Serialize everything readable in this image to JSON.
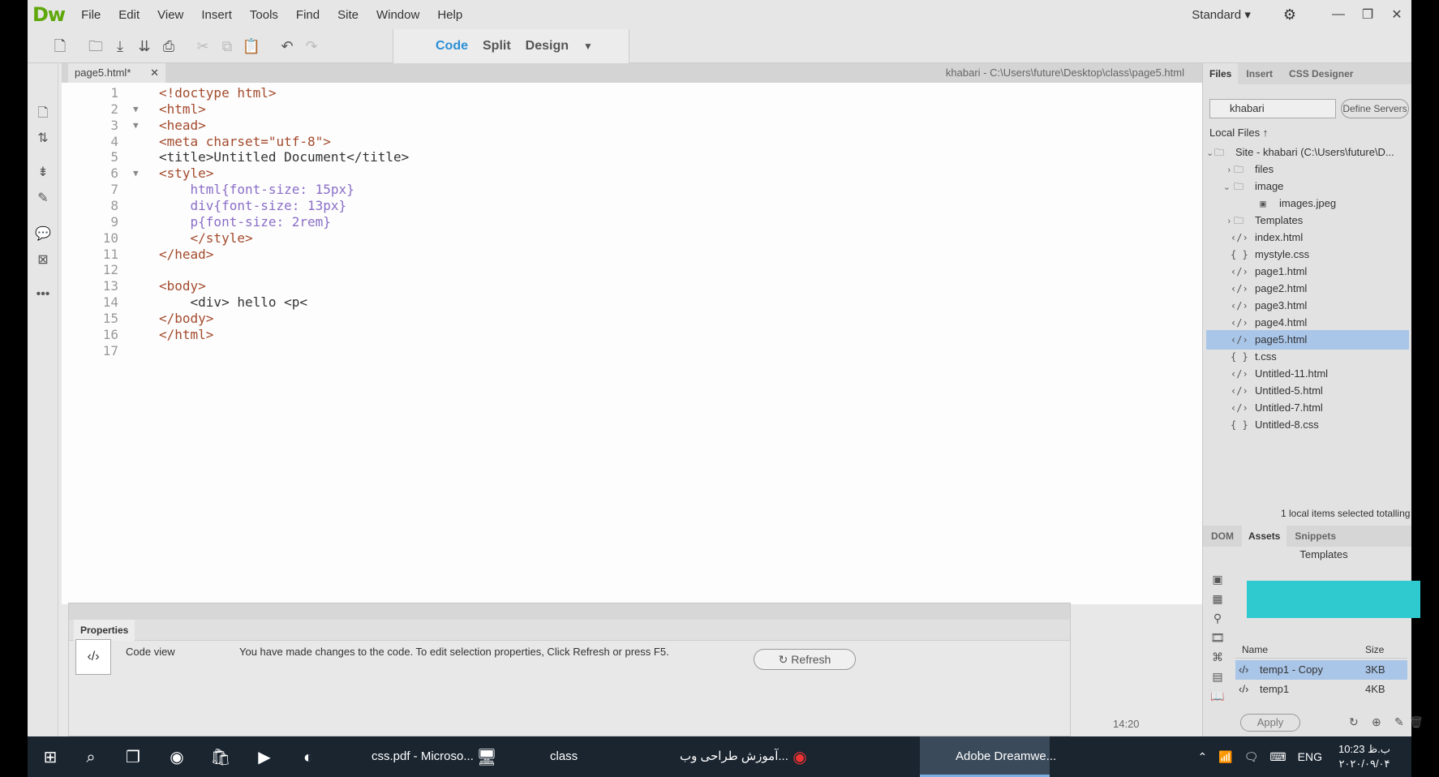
{
  "app": {
    "logo": "Dw",
    "menu": [
      "File",
      "Edit",
      "View",
      "Insert",
      "Tools",
      "Find",
      "Site",
      "Window",
      "Help"
    ],
    "workspace": "Standard",
    "view_switch": {
      "code": "Code",
      "split": "Split",
      "design": "Design"
    }
  },
  "document": {
    "tab_name": "page5.html*",
    "path": "khabari - C:\\Users\\future\\Desktop\\class\\page5.html",
    "line_numbers": [
      "1",
      "2",
      "3",
      "4",
      "5",
      "6",
      "7",
      "8",
      "9",
      "10",
      "11",
      "12",
      "13",
      "14",
      "15",
      "16",
      "17"
    ],
    "lines": [
      "<!doctype html>",
      "<html>",
      "<head>",
      "<meta charset=\"utf-8\">",
      "<title>Untitled Document</title>",
      "<style>",
      "    html{font-size: 15px}",
      "    div{font-size: 13px}",
      "    p{font-size: 2rem}",
      "    </style>",
      "</head>",
      "",
      "<body>",
      "    <div> hello <p<",
      "</body>",
      "</html>",
      ""
    ]
  },
  "properties": {
    "tab": "Properties",
    "view_label": "Code view",
    "message": "You have made changes to the code. To edit selection properties, Click Refresh or press F5.",
    "refresh": "Refresh"
  },
  "status": {
    "cursor": "14:20"
  },
  "files_panel": {
    "tabs": [
      "Files",
      "Insert",
      "CSS Designer"
    ],
    "site": "khabari",
    "define_servers": "Define Servers",
    "local_files": "Local Files",
    "tree": [
      {
        "name": "Site - khabari (C:\\Users\\future\\D...",
        "icon": "folder-icon",
        "level": 0
      },
      {
        "name": "files",
        "icon": "folder-icon",
        "level": 1
      },
      {
        "name": "image",
        "icon": "folder-icon",
        "level": 1
      },
      {
        "name": "images.jpeg",
        "icon": "image-icon",
        "level": 2
      },
      {
        "name": "Templates",
        "icon": "folder-icon",
        "level": 1
      },
      {
        "name": "index.html",
        "icon": "html-icon",
        "level": 1
      },
      {
        "name": "mystyle.css",
        "icon": "css-icon",
        "level": 1
      },
      {
        "name": "page1.html",
        "icon": "html-icon",
        "level": 1
      },
      {
        "name": "page2.html",
        "icon": "html-icon",
        "level": 1
      },
      {
        "name": "page3.html",
        "icon": "html-icon",
        "level": 1
      },
      {
        "name": "page4.html",
        "icon": "html-icon",
        "level": 1
      },
      {
        "name": "page5.html",
        "icon": "html-icon",
        "level": 1,
        "selected": true
      },
      {
        "name": "t.css",
        "icon": "css-icon",
        "level": 1
      },
      {
        "name": "Untitled-11.html",
        "icon": "html-icon",
        "level": 1
      },
      {
        "name": "Untitled-5.html",
        "icon": "html-icon",
        "level": 1
      },
      {
        "name": "Untitled-7.html",
        "icon": "html-icon",
        "level": 1
      },
      {
        "name": "Untitled-8.css",
        "icon": "css-icon",
        "level": 1
      }
    ],
    "status": "1 local items selected totalling ..."
  },
  "assets_panel": {
    "tabs": [
      "DOM",
      "Assets",
      "Snippets"
    ],
    "title": "Templates",
    "col_name": "Name",
    "col_size": "Size",
    "rows": [
      {
        "name": "temp1 - Copy",
        "size": "3KB"
      },
      {
        "name": "temp1",
        "size": "4KB"
      }
    ],
    "apply": "Apply"
  },
  "taskbar": {
    "apps": [
      "css.pdf - Microso...",
      "class",
      "آموزش طراحی وب...",
      "Adobe Dreamwe..."
    ],
    "lang": "ENG",
    "time": "10:23 ب.ظ",
    "date": "۲۰۲۰/۰۹/۰۴"
  },
  "colors": {
    "accent": "#2a8fd6",
    "selection": "#a9c5e8",
    "template_preview": "#2ecad0",
    "logo": "#5fa80b"
  }
}
